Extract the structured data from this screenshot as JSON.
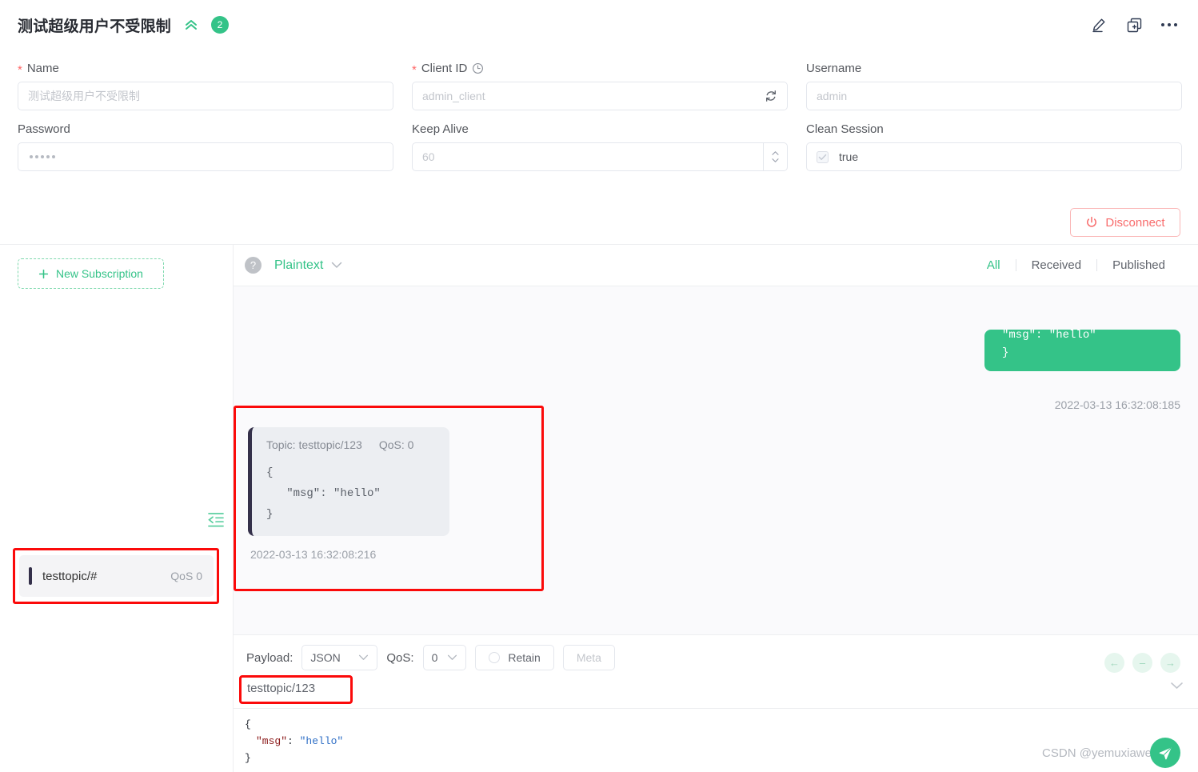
{
  "connection": {
    "title": "测试超级用户不受限制",
    "badge_count": "2",
    "collapse_icon": "double-chevron-up-icon",
    "actions": {
      "edit_icon": "pencil-icon",
      "duplicate_icon": "add-square-stack-icon",
      "more_icon": "more-horizontal-icon"
    },
    "fields": {
      "name": {
        "label": "Name",
        "required": true,
        "placeholder": "测试超级用户不受限制",
        "value": ""
      },
      "client_id": {
        "label": "Client ID",
        "required": true,
        "placeholder": "admin_client",
        "value": "",
        "info_icon": "clock-icon",
        "suffix_icon": "refresh-icon"
      },
      "username": {
        "label": "Username",
        "required": false,
        "placeholder": "admin",
        "value": ""
      },
      "password": {
        "label": "Password",
        "required": false,
        "masked_length": 5,
        "value": ""
      },
      "keep_alive": {
        "label": "Keep Alive",
        "required": false,
        "placeholder": "60",
        "value": "",
        "stepper_up": "▲",
        "stepper_down": "▼"
      },
      "clean_session": {
        "label": "Clean Session",
        "required": false,
        "value": "true",
        "checked": true
      }
    },
    "disconnect_button": {
      "label": "Disconnect",
      "icon": "power-icon",
      "color": "#f86b6b"
    }
  },
  "subscriptions": {
    "new_button": {
      "label": "New Subscription",
      "icon": "plus-icon"
    },
    "collapse_icon": "collapse-panel-left-icon",
    "items": [
      {
        "topic": "testtopic/#",
        "qos": "QoS 0",
        "selected": true,
        "highlighted": true
      }
    ]
  },
  "messages_toolbar": {
    "help_icon": "question-circle-icon",
    "format": "Plaintext",
    "format_chevron": "chevron-down-icon",
    "filters": [
      {
        "label": "All",
        "active": true
      },
      {
        "label": "Received",
        "active": false
      },
      {
        "label": "Published",
        "active": false
      }
    ]
  },
  "messages": [
    {
      "direction": "published",
      "body_line_1": "  \"msg\": \"hello\"",
      "body_line_2": "}",
      "timestamp": "2022-03-13 16:32:08:185",
      "color": "#34c388"
    },
    {
      "direction": "received",
      "topic_label": "Topic: testtopic/123",
      "qos_label": "QoS: 0",
      "body": "{\n   \"msg\": \"hello\"\n}",
      "timestamp": "2022-03-13 16:32:08:216",
      "highlighted": true
    }
  ],
  "publish": {
    "payload_label": "Payload:",
    "payload_value": "JSON",
    "qos_label": "QoS:",
    "qos_value": "0",
    "retain_label": "Retain",
    "retain_checked": false,
    "meta_label": "Meta",
    "meta_disabled": true,
    "topic_value": "testtopic/123",
    "topic_highlighted": true,
    "topic_chevron": "chevron-down-icon",
    "editor": {
      "line1": "{",
      "line2_key": "\"msg\"",
      "line2_colon": ": ",
      "line2_val": "\"hello\"",
      "line3": "}"
    },
    "nav_buttons": [
      {
        "icon": "arrow-left-icon",
        "glyph": "←"
      },
      {
        "icon": "minus-icon",
        "glyph": "–"
      },
      {
        "icon": "arrow-right-icon",
        "glyph": "→"
      }
    ],
    "send_icon": "send-icon"
  },
  "watermark": "CSDN @yemuxiaweiliang"
}
